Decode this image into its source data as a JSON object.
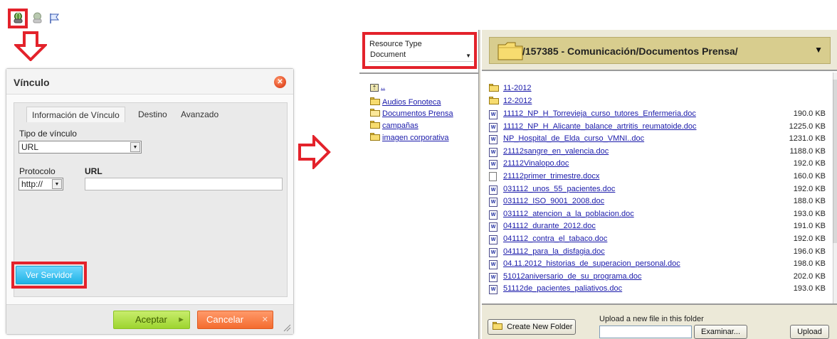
{
  "toolbar": {
    "icons": [
      "link-icon",
      "unlink-icon",
      "anchor-flag-icon"
    ]
  },
  "dialog": {
    "title": "Vínculo",
    "tabs": [
      "Información de Vínculo",
      "Destino",
      "Avanzado"
    ],
    "link_type_label": "Tipo de vínculo",
    "link_type_value": "URL",
    "protocol_label": "Protocolo",
    "protocol_value": "http://",
    "url_label": "URL",
    "url_value": "",
    "browse_server_label": "Ver Servidor",
    "ok_label": "Aceptar",
    "cancel_label": "Cancelar"
  },
  "browser": {
    "resource_type_label": "Resource Type",
    "resource_type_value": "Document",
    "current_path": "/157385 - Comunicación/Documentos Prensa/",
    "tree": [
      {
        "label": "..",
        "icon": "folder-up-icon"
      },
      {
        "label": "Audios Fonoteca",
        "icon": "folder-icon"
      },
      {
        "label": "Documentos Prensa",
        "icon": "folder-open-icon"
      },
      {
        "label": "campañas",
        "icon": "folder-icon"
      },
      {
        "label": "imagen corporativa",
        "icon": "folder-icon"
      }
    ],
    "folders": [
      "11-2012",
      "12-2012"
    ],
    "files": [
      {
        "name": "11112_NP_H_Torrevieja_curso_tutores_Enfermeria.doc",
        "size": "190.0 KB",
        "type": "word"
      },
      {
        "name": "11112_NP_H_Alicante_balance_artritis_reumatoide.doc",
        "size": "1225.0 KB",
        "type": "word"
      },
      {
        "name": "NP_Hospital_de_Elda_curso_VMNI..doc",
        "size": "1231.0 KB",
        "type": "word"
      },
      {
        "name": "21112sangre_en_valencia.doc",
        "size": "1188.0 KB",
        "type": "word"
      },
      {
        "name": "21112Vinalopo.doc",
        "size": "192.0 KB",
        "type": "word"
      },
      {
        "name": "21112primer_trimestre.docx",
        "size": "160.0 KB",
        "type": "blank"
      },
      {
        "name": "031112_unos_55_pacientes.doc",
        "size": "192.0 KB",
        "type": "word"
      },
      {
        "name": "031112_ISO_9001_2008.doc",
        "size": "188.0 KB",
        "type": "word"
      },
      {
        "name": "031112_atencion_a_la_poblacion.doc",
        "size": "193.0 KB",
        "type": "word"
      },
      {
        "name": "041112_durante_2012.doc",
        "size": "191.0 KB",
        "type": "word"
      },
      {
        "name": "041112_contra_el_tabaco.doc",
        "size": "192.0 KB",
        "type": "word"
      },
      {
        "name": "041112_para_la_disfagia.doc",
        "size": "196.0 KB",
        "type": "word"
      },
      {
        "name": "04.11.2012_historias_de_superacion_personal.doc",
        "size": "198.0 KB",
        "type": "word"
      },
      {
        "name": "51012aniversario_de_su_programa.doc",
        "size": "202.0 KB",
        "type": "word"
      },
      {
        "name": "51112de_pacientes_paliativos.doc",
        "size": "193.0 KB",
        "type": "word"
      }
    ],
    "create_folder_label": "Create New Folder",
    "upload_prompt": "Upload a new file in this folder",
    "browse_label": "Examinar...",
    "upload_label": "Upload"
  },
  "colors": {
    "highlight_red": "#e3222b",
    "browse_button": "#1eb1e4",
    "ok_button": "#9dd52f",
    "cancel_button": "#f46b2f",
    "path_bar": "#d8cd8e"
  }
}
